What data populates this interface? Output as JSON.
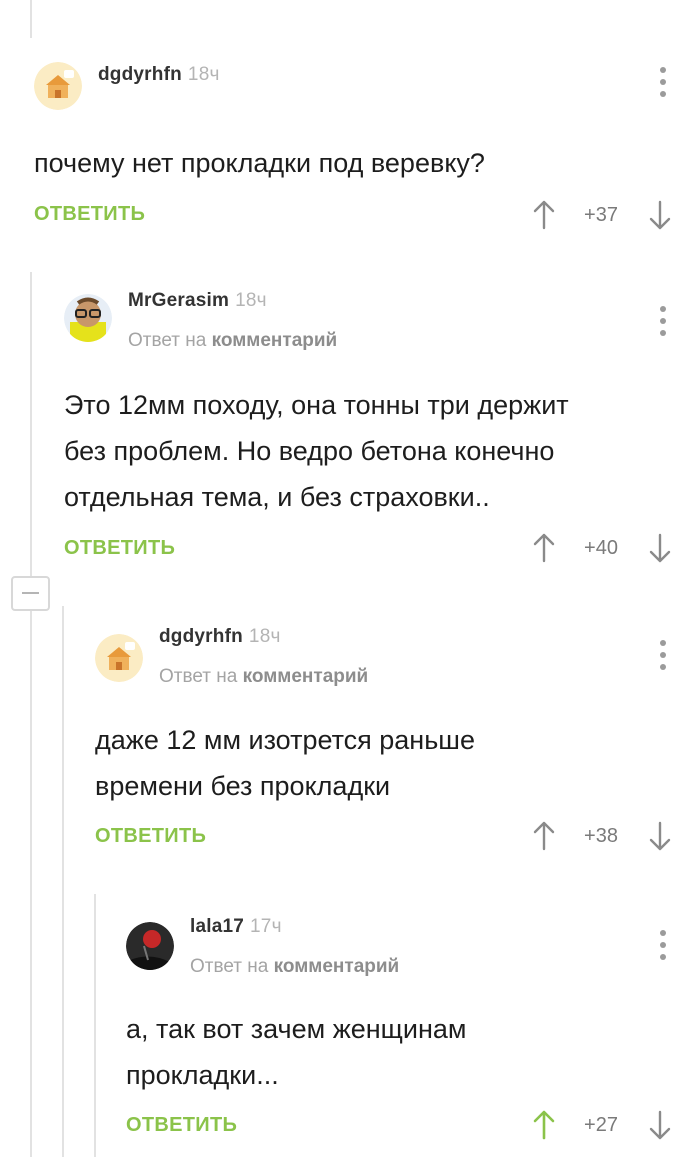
{
  "comments": [
    {
      "user": "dgdyrhfn",
      "time": "18ч",
      "reply_prefix": "",
      "reply_target": "",
      "text_lines": [
        "почему нет прокладки под веревку?"
      ],
      "reply_label": "ОТВЕТИТЬ",
      "score": "+37"
    },
    {
      "user": "MrGerasim",
      "time": "18ч",
      "reply_prefix": "Ответ на",
      "reply_target": "комментарий",
      "text_lines": [
        "Это 12мм походу, она тонны три держит",
        "без проблем. Но ведро бетона конечно",
        "отдельная тема, и без страховки.."
      ],
      "reply_label": "ОТВЕТИТЬ",
      "score": "+40"
    },
    {
      "user": "dgdyrhfn",
      "time": "18ч",
      "reply_prefix": "Ответ на",
      "reply_target": "комментарий",
      "text_lines": [
        "даже 12 мм изотрется раньше",
        "времени без прокладки"
      ],
      "reply_label": "ОТВЕТИТЬ",
      "score": "+38"
    },
    {
      "user": "lala17",
      "time": "17ч",
      "reply_prefix": "Ответ на",
      "reply_target": "комментарий",
      "text_lines": [
        "а, так вот зачем женщинам",
        "прокладки..."
      ],
      "reply_label": "ОТВЕТИТЬ",
      "score": "+27"
    }
  ],
  "colors": {
    "accent": "#8bc34a",
    "upvoted": "#8bc34a",
    "muted": "#a4a4a4",
    "thread_line": "#e2e2e2"
  },
  "icons": {
    "menu": "more-vert-icon",
    "upvote": "arrow-up-icon",
    "downvote": "arrow-down-icon",
    "collapse": "minus-icon"
  }
}
